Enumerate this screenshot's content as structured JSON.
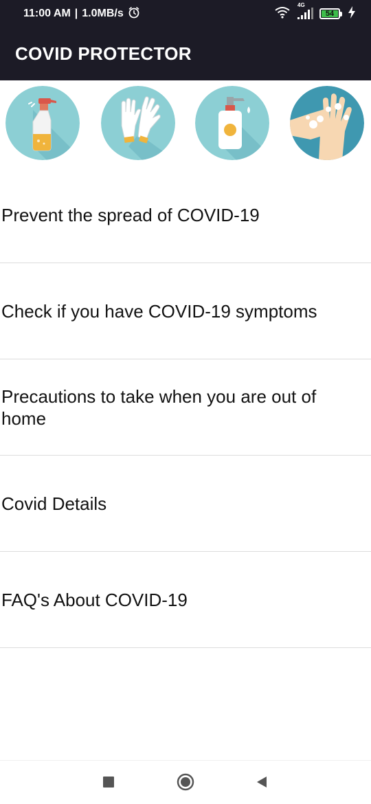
{
  "status_bar": {
    "time": "11:00 AM",
    "separator": "|",
    "speed": "1.0MB/s",
    "alarm_icon": "alarm-icon",
    "wifi_icon": "wifi-icon",
    "network_type": "4G",
    "signal_icon": "signal-icon",
    "battery_level": "54",
    "charging_icon": "charging-bolt-icon"
  },
  "app_bar": {
    "title": "COVID PROTECTOR"
  },
  "icons": [
    {
      "name": "spray-bottle-icon"
    },
    {
      "name": "gloves-icon"
    },
    {
      "name": "soap-dispenser-icon"
    },
    {
      "name": "hand-washing-icon"
    }
  ],
  "menu": {
    "items": [
      {
        "label": "Prevent the spread of COVID-19"
      },
      {
        "label": "Check if you have COVID-19 symptoms"
      },
      {
        "label": "Precautions to take when you are out of home"
      },
      {
        "label": "Covid Details"
      },
      {
        "label": "FAQ's About COVID-19"
      }
    ]
  },
  "nav_bar": {
    "recents_icon": "square-icon",
    "home_icon": "circle-home-icon",
    "back_icon": "back-triangle-icon"
  },
  "colors": {
    "app_bar": "#1c1b26",
    "circle_light": "#8ccfd4",
    "circle_dark": "#3f98b0",
    "divider": "#dcdcdc",
    "battery": "#3dbd4a"
  }
}
